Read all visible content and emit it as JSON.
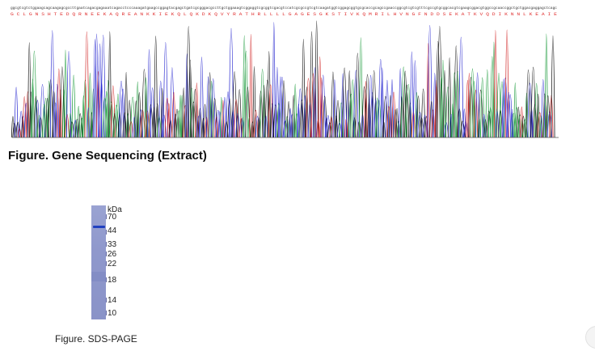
{
  "sequence_strip": {
    "nucleotides": "ggcgtcgtctggaagcagcaagagcgccttgaatcagacgagaaatcagacctcccaaagatgaagccggagtacgagctgatcgcgggacgccttgctggaaagtcggaggtcgcggtcgacgtccatcgcgccgtcgtcaagatggtcggagcggtgcgcaccgcagccgaaccggcgtcgtcgtttcgccgtgcggcacgtcgaagcggacgtggccgcaaccggctgctggacgaggagctcagc",
    "amino_acids": "G C L G N S H T E D Q R N E E K A Q R E A N K K I E K Q L Q K D K Q V Y R A T H R L L L L G A G E S G K S T I V K Q M R I L H V N G F N D D S E K A T K V Q D I K N N L K E A I E",
    "colors": {
      "A": "#1a9a3a",
      "C": "#2a2ad0",
      "G": "#111111",
      "T": "#d02020",
      "aa_text": "#e03030"
    }
  },
  "captions": {
    "gene_sequencing": "Figure. Gene Sequencing (Extract)",
    "sds_page": "Figure. SDS-PAGE"
  },
  "gel": {
    "unit_label": "kDa",
    "markers": [
      "70",
      "44",
      "33",
      "26",
      "22",
      "18",
      "14",
      "10"
    ],
    "band_marker": "44",
    "lane_color": "#8f98cc",
    "band_color": "#2040c0"
  }
}
